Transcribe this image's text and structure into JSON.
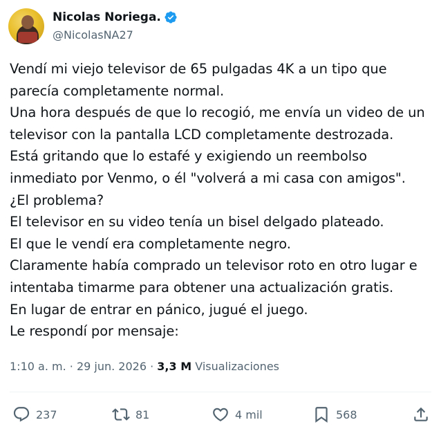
{
  "author": {
    "display_name": "Nicolas Noriega.",
    "handle": "@NicolasNA27",
    "verified": true
  },
  "tweet": {
    "lines": [
      "Vendí mi viejo televisor de 65 pulgadas 4K a un tipo que",
      "parecía completamente normal.",
      "Una hora después de que lo recogió, me envía un video de un",
      "televisor con la pantalla LCD completamente destrozada.",
      "Está gritando que lo estafé y exigiendo un reembolso",
      "inmediato por Venmo, o él \"volverá a mi casa con amigos\".",
      "¿El problema?",
      "El televisor en su video tenía un bisel delgado plateado.",
      "El que le vendí era completamente negro.",
      "Claramente había comprado un televisor roto en otro lugar e",
      "intentaba timarme para obtener una actualización gratis.",
      "En lugar de entrar en pánico, jugué el juego.",
      "Le respondí por mensaje:"
    ]
  },
  "meta": {
    "time": "1:10 a. m.",
    "separator": "·",
    "date": "29 jun. 2026",
    "views_count": "3,3 M",
    "views_label": "Visualizaciones"
  },
  "actions": {
    "replies": "237",
    "reposts": "81",
    "likes": "4 mil",
    "bookmarks": "568"
  },
  "colors": {
    "text": "#0f1419",
    "secondary": "#536471",
    "verified": "#1d9bf0",
    "divider": "#eff3f4"
  },
  "icons": [
    "verified-badge-icon",
    "reply-icon",
    "repost-icon",
    "like-icon",
    "bookmark-icon",
    "share-icon"
  ]
}
